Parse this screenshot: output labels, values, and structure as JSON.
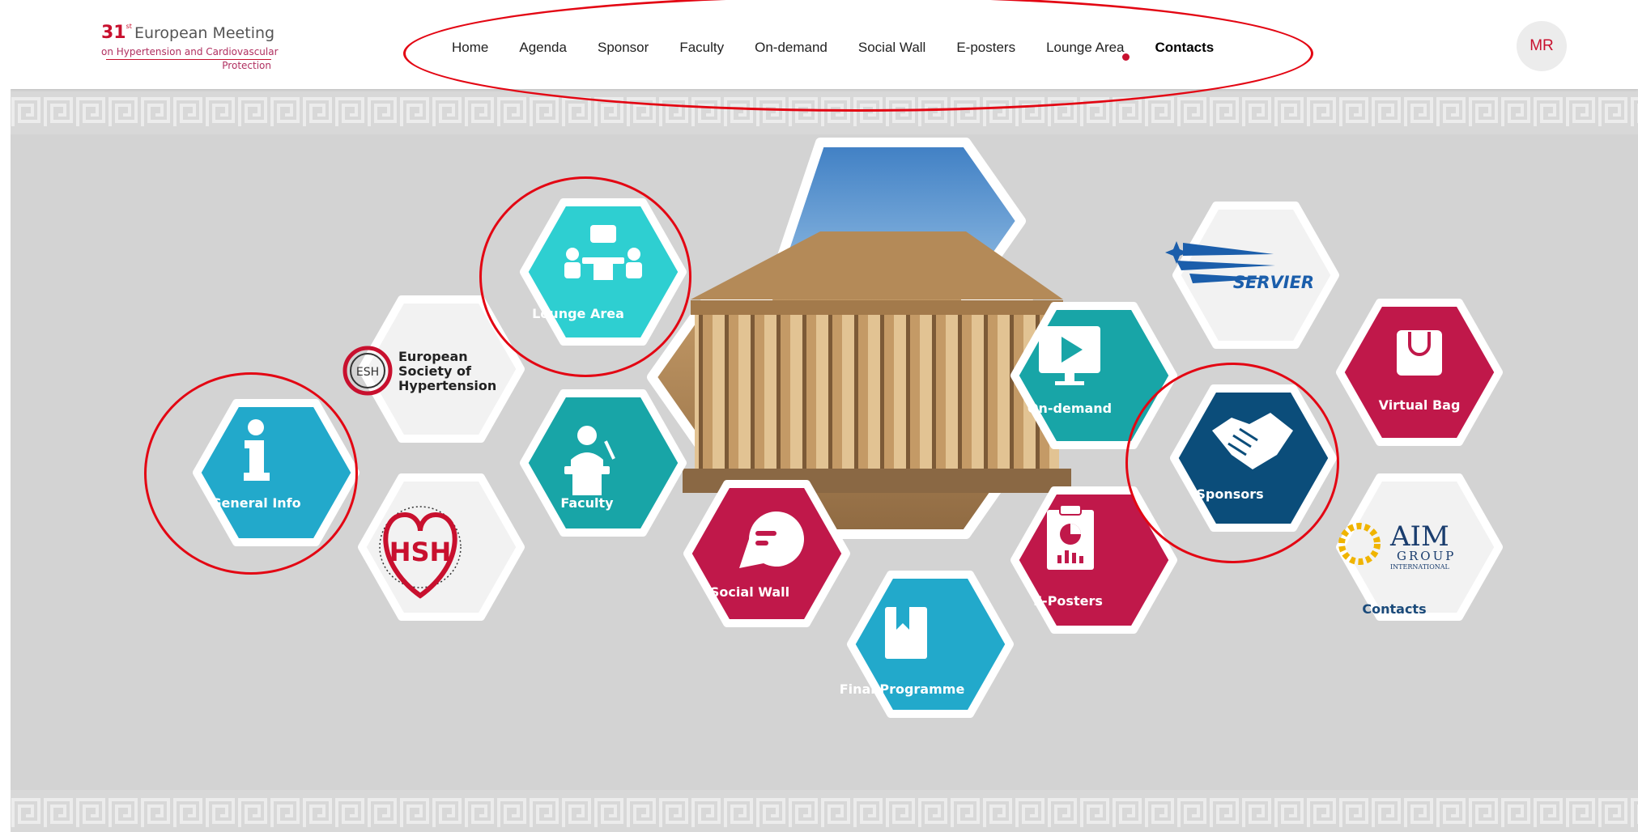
{
  "header": {
    "logo": {
      "number": "31",
      "suffix": "st",
      "line1": "European Meeting",
      "line2": "on Hypertension and Cardiovascular",
      "line3": "Protection"
    },
    "nav": [
      {
        "label": "Home"
      },
      {
        "label": "Agenda"
      },
      {
        "label": "Sponsor"
      },
      {
        "label": "Faculty"
      },
      {
        "label": "On-demand"
      },
      {
        "label": "Social Wall"
      },
      {
        "label": "E-posters"
      },
      {
        "label": "Lounge Area",
        "notification": true
      },
      {
        "label": "Contacts",
        "active": true
      }
    ],
    "avatar_initials": "MR"
  },
  "tiles": {
    "general_info": "General Info",
    "lounge_area": "Lounge Area",
    "faculty": "Faculty",
    "social_wall": "Social Wall",
    "final_programme": "Final Programme",
    "on_demand": "On-demand",
    "e_posters": "E-Posters",
    "sponsors": "Sponsors",
    "virtual_bag": "Virtual Bag",
    "contacts": "Contacts"
  },
  "logos": {
    "esh": {
      "badge": "ESH",
      "lines": [
        "European",
        "Society of",
        "Hypertension"
      ]
    },
    "hsh": {
      "badge": "HSH",
      "ring_text": "HELLENIC SOCIETY OF HYPERTENSION 1973"
    },
    "servier": "SERVIER",
    "aim": {
      "main": "AIM",
      "sub": "GROUP",
      "sub2": "INTERNATIONAL"
    }
  },
  "colors": {
    "accent": "#c8102e",
    "annotation": "#e30613",
    "teal_light": "#2ecfd1",
    "teal": "#18a5a7",
    "blue": "#22a9cb",
    "crimson": "#c0184a",
    "navy": "#0b4d7a",
    "light_gray": "#f2f2f2",
    "background": "#d3d3d3"
  }
}
